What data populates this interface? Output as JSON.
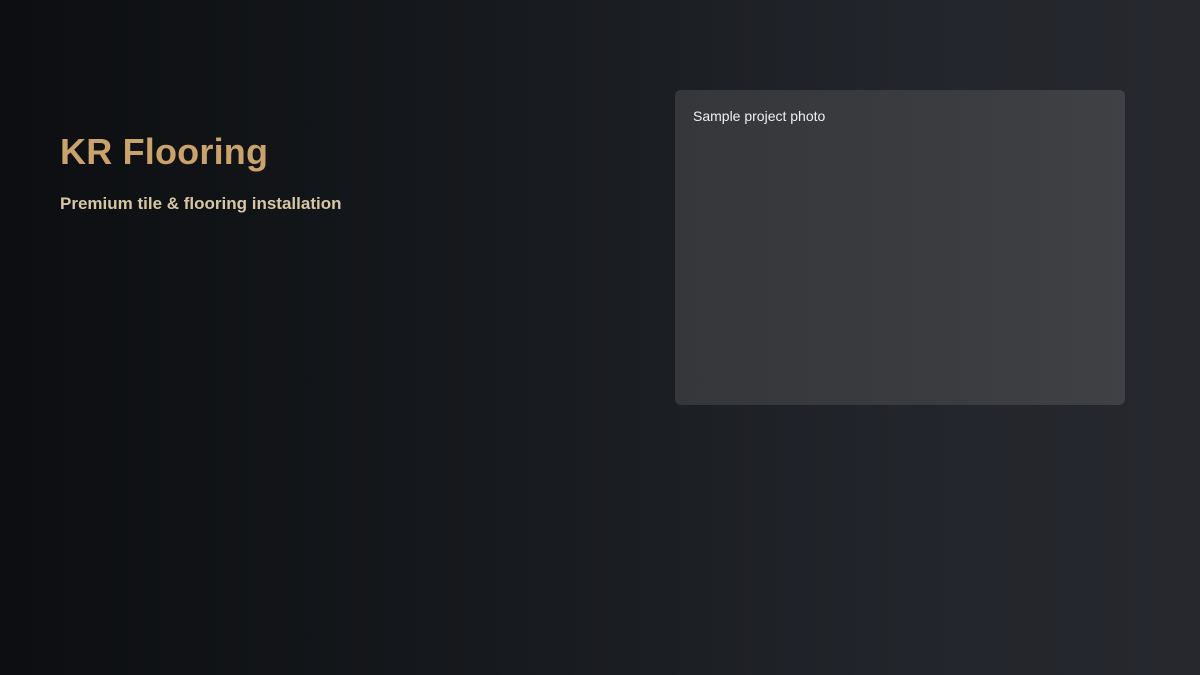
{
  "hero": {
    "title": "KR Flooring",
    "tagline": "Premium tile & flooring installation"
  },
  "photo": {
    "caption": "Sample project photo"
  },
  "colors": {
    "title": "#c9a36b",
    "tagline": "#d6c6a4",
    "caption": "#f0f0f0",
    "card_background": "#3a3c40",
    "page_background_dark": "#0c0e11",
    "page_background_light": "#26282e"
  }
}
